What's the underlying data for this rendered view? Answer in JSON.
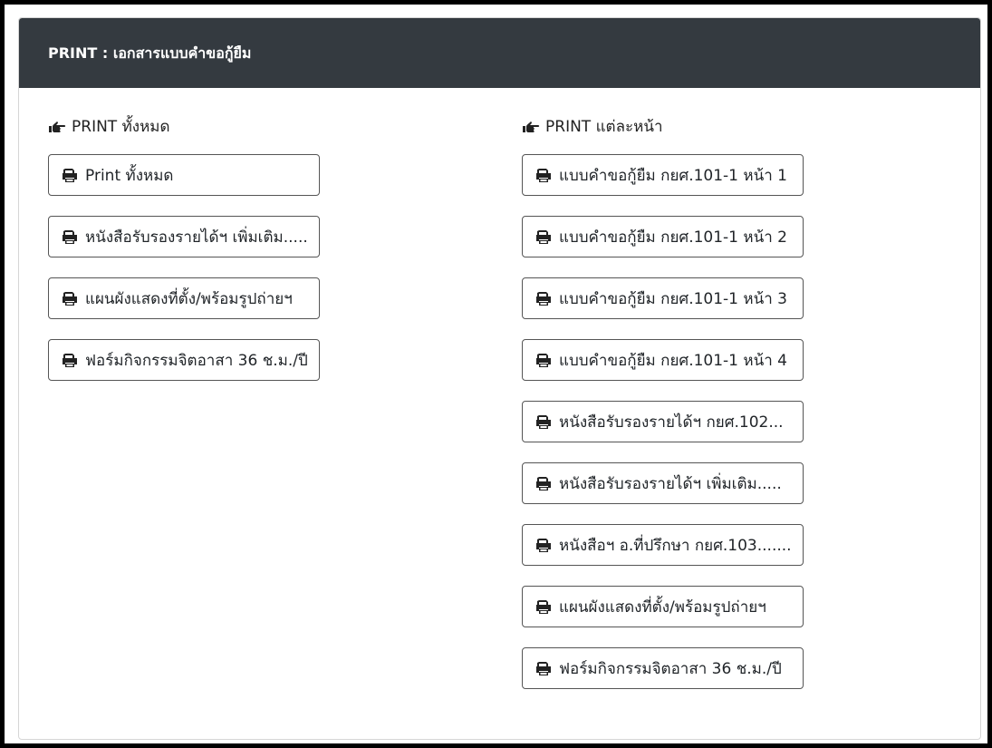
{
  "card": {
    "title": "PRINT : เอกสารแบบคำขอกู้ยืม"
  },
  "left": {
    "heading": "PRINT ทั้งหมด",
    "buttons": [
      "Print ทั้งหมด",
      "หนังสือรับรองรายได้ฯ เพิ่มเติม.....",
      "แผนผังแสดงที่ตั้ง/พร้อมรูปถ่ายฯ",
      "ฟอร์มกิจกรรมจิตอาสา 36 ช.ม./ปี"
    ]
  },
  "right": {
    "heading": "PRINT แต่ละหน้า",
    "buttons": [
      "แบบคำขอกู้ยืม กยศ.101-1 หน้า 1",
      "แบบคำขอกู้ยืม กยศ.101-1 หน้า 2",
      "แบบคำขอกู้ยืม กยศ.101-1 หน้า 3",
      "แบบคำขอกู้ยืม กยศ.101-1 หน้า 4",
      "หนังสือรับรองรายได้ฯ กยศ.102...",
      "หนังสือรับรองรายได้ฯ เพิ่มเติม.....",
      "หนังสือฯ อ.ที่ปรึกษา กยศ.103.......",
      "แผนผังแสดงที่ตั้ง/พร้อมรูปถ่ายฯ",
      "ฟอร์มกิจกรรมจิตอาสา 36 ช.ม./ปี"
    ]
  },
  "colors": {
    "header_bg": "#343a40",
    "header_text": "#ffffff",
    "button_border": "#555555"
  }
}
